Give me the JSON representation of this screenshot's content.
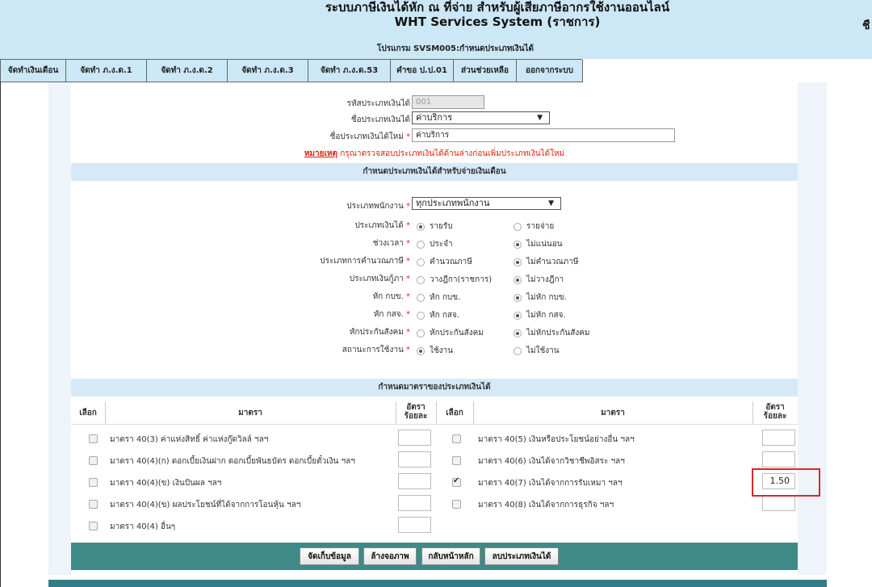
{
  "header": {
    "title_line1": "ระบบภาษีเงินได้หัก ณ ที่จ่าย สำหรับผู้เสียภาษีอากรใช้งานออนไลน์",
    "title_line2": "WHT Services System  (ราชการ)",
    "program": "โปรแกรม SVSM005:กำหนดประเภทเงินได้",
    "right_fragment": "ชื"
  },
  "nav": [
    {
      "label": "จัดทำเงินเดือน"
    },
    {
      "label": "จัดทำ ภ.ง.ด.1"
    },
    {
      "label": "จัดทำ ภ.ง.ด.2"
    },
    {
      "label": "จัดทำ ภ.ง.ด.3"
    },
    {
      "label": "จัดทำ ภ.ง.ด.53"
    },
    {
      "label": "คำขอ ป.ป.01"
    },
    {
      "label": "ส่วนช่วยเหลือ"
    },
    {
      "label": "ออกจากระบบ"
    }
  ],
  "form": {
    "code_label": "รหัสประเภทเงินได้",
    "code_value": "001",
    "name_label": "ชื่อประเภทเงินได้",
    "name_value": "ค่าบริการ",
    "new_name_label": "ชื่อประเภทเงินได้ใหม่",
    "required_mark": "*",
    "new_name_value": "ค่าบริการ",
    "note_prefix": "หมายเหตุ",
    "note_text": " กรุณาตรวจสอบประเภทเงินได้ด้านล่างก่อนเพิ่มประเภทเงินได้ใหม่"
  },
  "salary_section": {
    "title": "กำหนดประเภทเงินได้สำหรับจ่ายเงินเดือน",
    "employee_type_label": "ประเภทพนักงาน",
    "employee_type_value": "ทุกประเภทพนักงาน",
    "rows": [
      {
        "label": "ประเภทเงินได้",
        "opt1": "รายรับ",
        "opt2": "รายจ่าย",
        "selected": 1
      },
      {
        "label": "ช่วงเวลา",
        "opt1": "ประจำ",
        "opt2": "ไม่แน่นอน",
        "selected": 2
      },
      {
        "label": "ประเภทการคำนวณภาษี",
        "opt1": "คำนวณภาษี",
        "opt2": "ไม่คำนวณภาษี",
        "selected": 2
      },
      {
        "label": "ประเภทเงินกู้ภา",
        "opt1": "วางฎีกา(ราชการ)",
        "opt2": "ไม่วางฎีกา",
        "selected": 2
      },
      {
        "label": "หัก กบข.",
        "opt1": "หัก กบข.",
        "opt2": "ไม่หัก กบข.",
        "selected": 2
      },
      {
        "label": "หัก กสจ.",
        "opt1": "หัก กสจ.",
        "opt2": "ไม่หัก กสจ.",
        "selected": 2
      },
      {
        "label": "หักประกันสังคม",
        "opt1": "หักประกันสังคม",
        "opt2": "ไม่หักประกันสังคม",
        "selected": 2
      },
      {
        "label": "สถานะการใช้งาน",
        "opt1": "ใช้งาน",
        "opt2": "ไม่ใช้งาน",
        "selected": 1
      }
    ]
  },
  "tax_section": {
    "title": "กำหนดมาตราของประเภทเงินได้",
    "col_select": "เลือก",
    "col_section": "มาตรา",
    "col_rate_line1": "อัตรา",
    "col_rate_line2": "ร้อยละ",
    "left_rows": [
      {
        "text": "มาตรา 40(3) ค่าแห่งสิทธิ์ ค่าแห่งกู๊ดวิลล์ ฯลฯ",
        "checked": false,
        "rate": ""
      },
      {
        "text": "มาตรา 40(4)(ก) ดอกเบี้ยเงินฝาก ดอกเบี้ยพันธบัตร ดอกเบี้ยตั๋วเงิน ฯลฯ",
        "checked": false,
        "rate": ""
      },
      {
        "text": "มาตรา 40(4)(ข) เงินปันผล ฯลฯ",
        "checked": false,
        "rate": ""
      },
      {
        "text": "มาตรา 40(4)(ข) ผลประโยชน์ที่ได้จากการโอนหุ้น ฯลฯ",
        "checked": false,
        "rate": ""
      },
      {
        "text": "มาตรา 40(4) อื่นๆ",
        "checked": false,
        "rate": ""
      }
    ],
    "right_rows": [
      {
        "text": "มาตรา 40(5) เงินหรือประโยชน์อย่างอื่น ฯลฯ",
        "checked": false,
        "rate": ""
      },
      {
        "text": "มาตรา 40(6) เงินได้จากวิชาชีพอิสระ ฯลฯ",
        "checked": false,
        "rate": ""
      },
      {
        "text": "มาตรา 40(7) เงินได้จากการรับเหมา ฯลฯ",
        "checked": true,
        "rate": "1.50"
      },
      {
        "text": "มาตรา 40(8) เงินได้จากการธุรกิจ ฯลฯ",
        "checked": false,
        "rate": ""
      }
    ]
  },
  "buttons": {
    "save": "จัดเก็บข้อมูล",
    "clear": "ล้างจอภาพ",
    "back": "กลับหน้าหลัก",
    "delete": "ลบประเภทเงินได้"
  },
  "colors": {
    "header_bg": "#cce7f5",
    "section_bg": "#d6e9f6",
    "footer_bar": "#3e8a86",
    "highlight": "#d9262c",
    "required": "#ee2222"
  }
}
